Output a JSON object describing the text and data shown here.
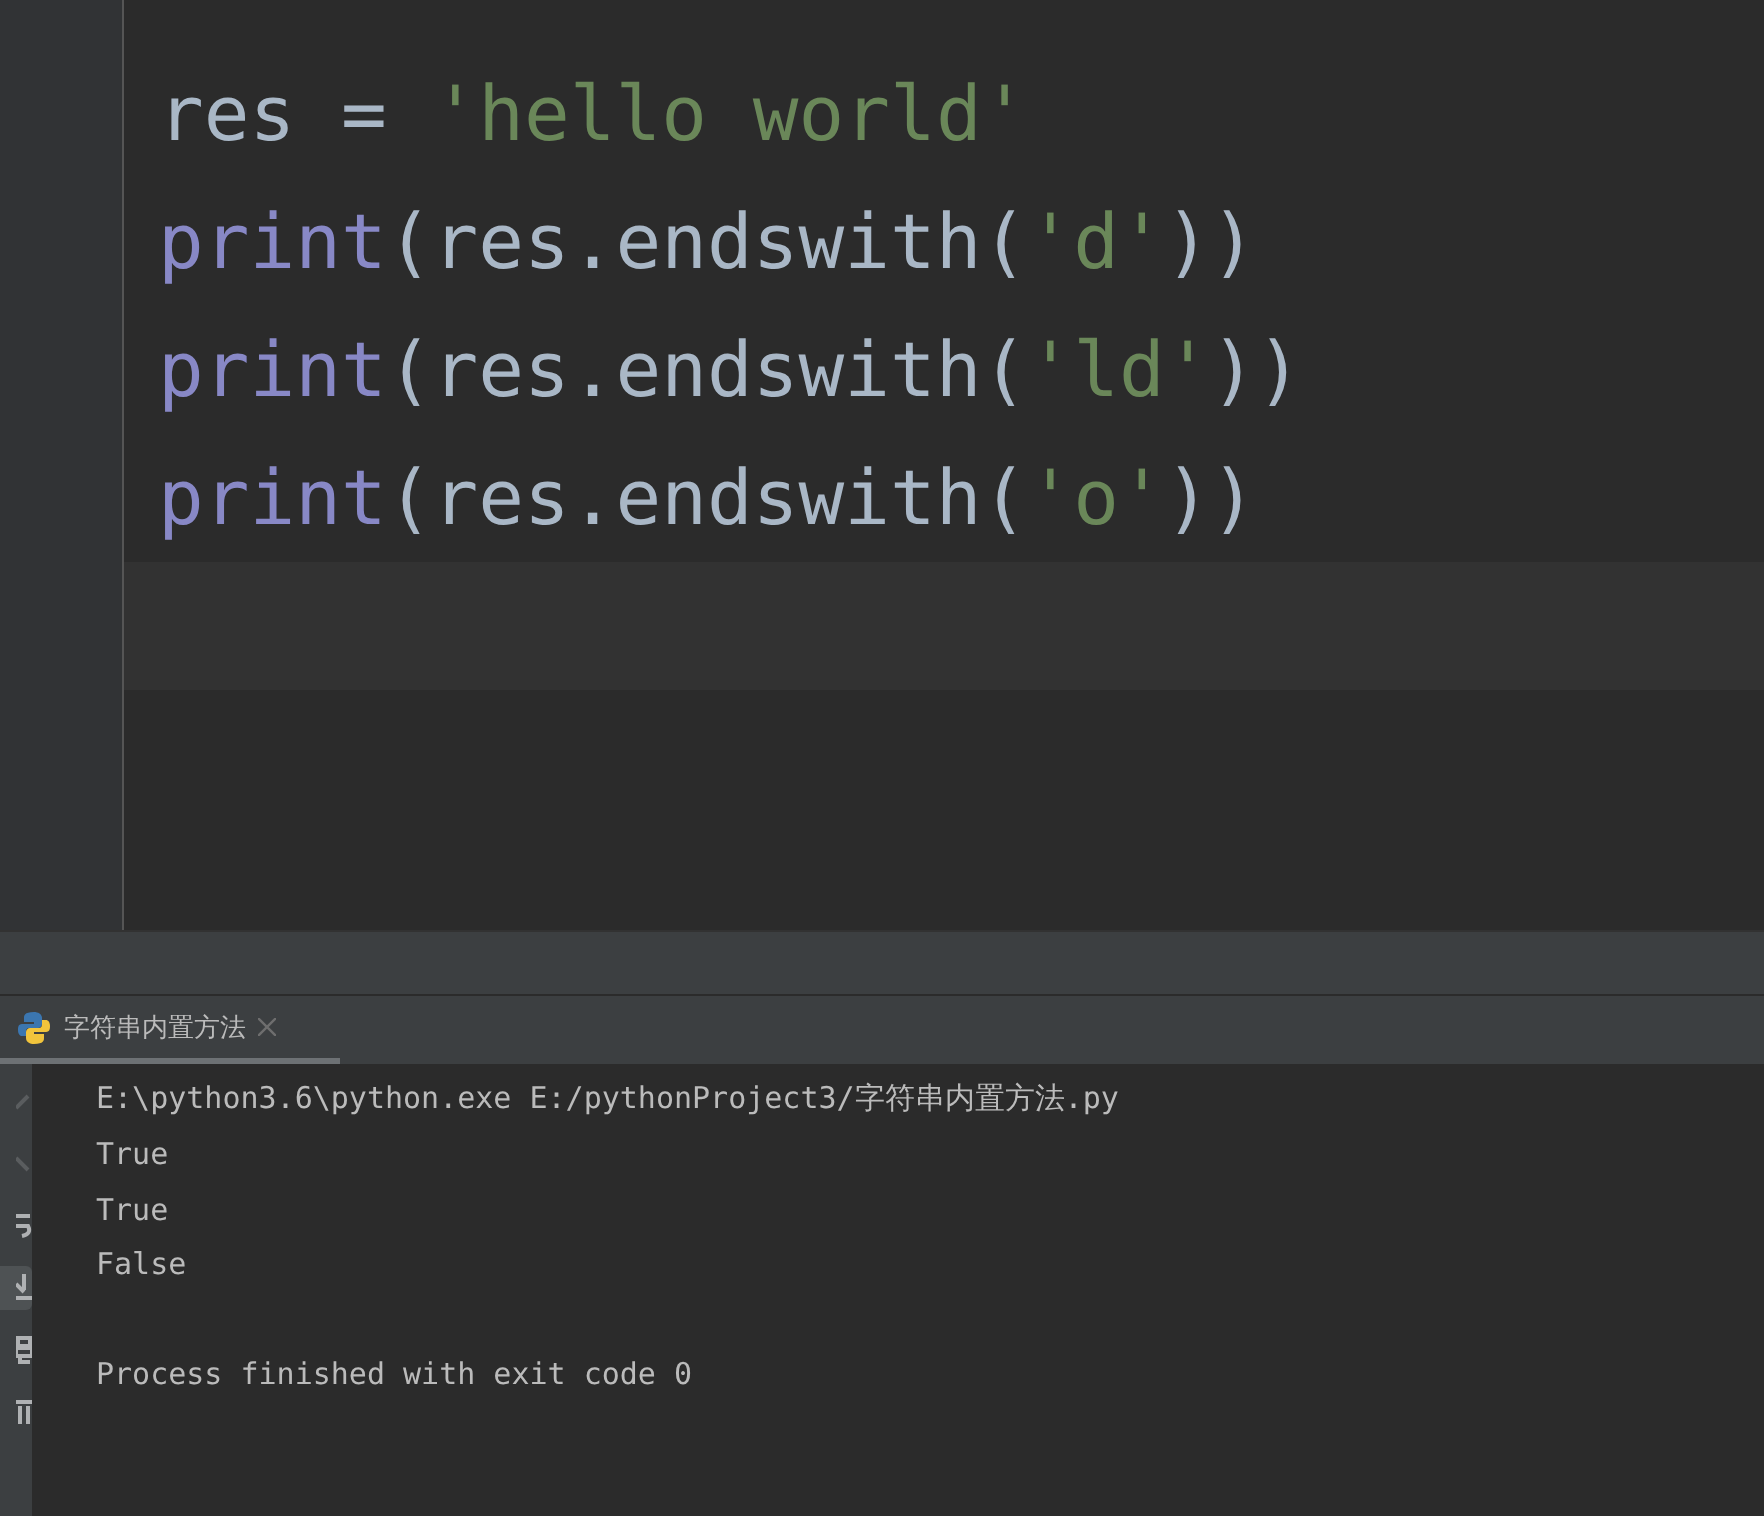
{
  "editor": {
    "lines": [
      {
        "tokens": [
          {
            "kind": "ident",
            "text": "res"
          },
          {
            "kind": "op",
            "text": " = "
          },
          {
            "kind": "string",
            "text": "'hello world'"
          }
        ]
      },
      {
        "tokens": [
          {
            "kind": "builtin",
            "text": "print"
          },
          {
            "kind": "ident",
            "text": "(res.endswith("
          },
          {
            "kind": "string",
            "text": "'d'"
          },
          {
            "kind": "ident",
            "text": "))"
          }
        ]
      },
      {
        "tokens": [
          {
            "kind": "builtin",
            "text": "print"
          },
          {
            "kind": "ident",
            "text": "(res.endswith("
          },
          {
            "kind": "string",
            "text": "'ld'"
          },
          {
            "kind": "ident",
            "text": "))"
          }
        ]
      },
      {
        "tokens": [
          {
            "kind": "builtin",
            "text": "print"
          },
          {
            "kind": "ident",
            "text": "(res.endswith("
          },
          {
            "kind": "string",
            "text": "'o'"
          },
          {
            "kind": "ident",
            "text": "))"
          }
        ]
      }
    ]
  },
  "run_panel": {
    "tabs": [
      {
        "label": "字符串内置方法",
        "selected": true
      }
    ],
    "toolbar": [
      {
        "kind": "up",
        "selected": false
      },
      {
        "kind": "down",
        "selected": false
      },
      {
        "kind": "wrap",
        "selected": false
      },
      {
        "kind": "scroll",
        "selected": true
      },
      {
        "kind": "print",
        "selected": false
      },
      {
        "kind": "trash",
        "selected": false
      }
    ],
    "output": [
      "E:\\python3.6\\python.exe E:/pythonProject3/字符串内置方法.py",
      "True",
      "True",
      "False"
    ],
    "exit_message": "Process finished with exit code 0"
  }
}
